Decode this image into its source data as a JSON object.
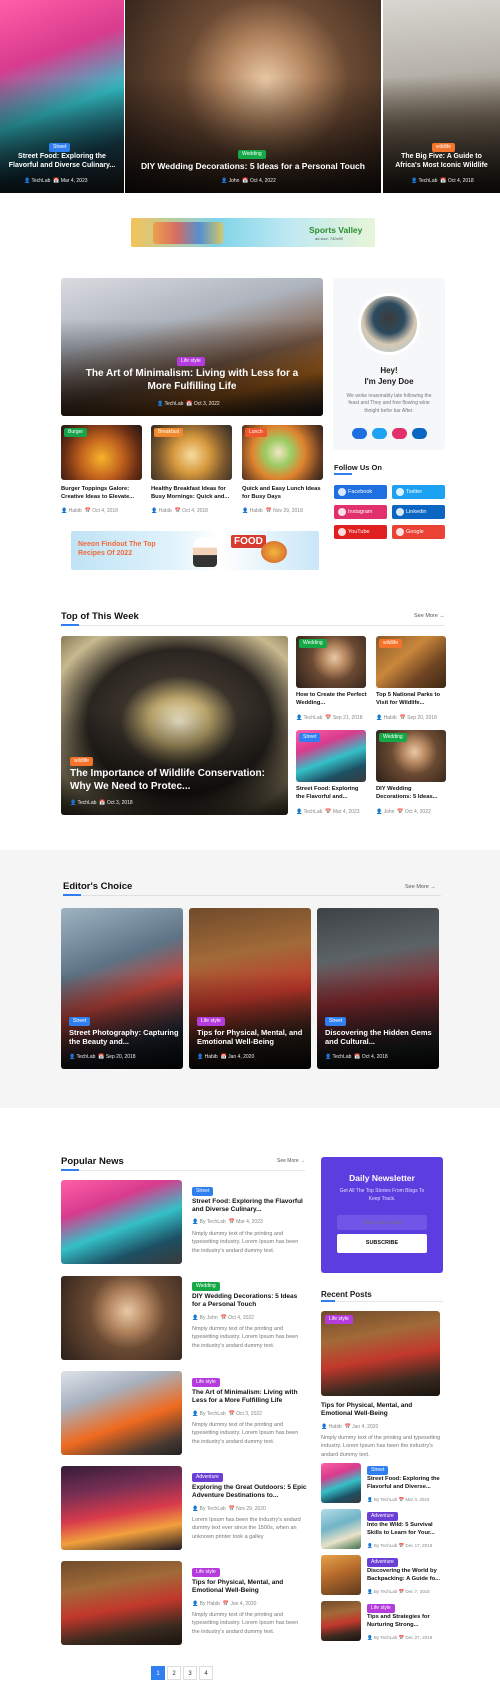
{
  "hero": [
    {
      "category": "Street",
      "title": "Street Food: Exploring the Flavorful and Diverse Culinary...",
      "author": "TechLab",
      "date": "Mar 4, 2023"
    },
    {
      "category": "Wedding",
      "title": "DIY Wedding Decorations: 5 Ideas for a Personal Touch",
      "author": "John",
      "date": "Oct 4, 2022"
    },
    {
      "category": "wildlife",
      "title": "The Big Five: A Guide to Africa's Most Iconic Wildlife",
      "author": "TechLab",
      "date": "Oct 4, 2018"
    }
  ],
  "banner_top": {
    "text": "Sports Valley",
    "sub": "ad size: 740x90"
  },
  "featured": {
    "category": "Life style",
    "title": "The Art of Minimalism: Living with Less for a More Fulfilling Life",
    "author": "TechLab",
    "date": "Oct 3, 2022"
  },
  "small_cards": [
    {
      "category": "Burger",
      "title": "Burger Toppings Galore: Creative Ideas to Elevate...",
      "author": "Habib",
      "date": "Oct 4, 2018"
    },
    {
      "category": "Breakfast",
      "title": "Healthy Breakfast Ideas for Busy Mornings: Quick and...",
      "author": "Habib",
      "date": "Oct 4, 2018"
    },
    {
      "category": "Lunch",
      "title": "Quick and Easy Lunch Ideas for Busy Days",
      "author": "Habib",
      "date": "Nov 29, 2018"
    }
  ],
  "profile": {
    "greeting": "Hey!",
    "name": "I'm Jeny Doe",
    "bio": "We woke reasonably late following the feast and They and free flowing wine thnight befor bar After."
  },
  "follow": {
    "title": "Follow Us On",
    "items": [
      {
        "label": "Facebook",
        "color": "#1e6fe0"
      },
      {
        "label": "Twitter",
        "color": "#1da1f2"
      },
      {
        "label": "Instagram",
        "color": "#e1306c"
      },
      {
        "label": "Linkedin",
        "color": "#0a66c2"
      },
      {
        "label": "YouTube",
        "color": "#e02020"
      },
      {
        "label": "Google",
        "color": "#ea4335"
      }
    ]
  },
  "banner_mid": {
    "text": "Neeon Findout The Top Recipes Of 2022",
    "badge": "FOOD"
  },
  "top_week": {
    "title": "Top of This Week",
    "see_more": "See More",
    "main": {
      "category": "wildlife",
      "title": "The Importance of Wildlife Conservation: Why We Need to Protec...",
      "author": "TechLab",
      "date": "Oct 3, 2018"
    },
    "items": [
      {
        "category": "Wedding",
        "title": "How to Create the Perfect Wedding...",
        "author": "TechLab",
        "date": "Sep 21, 2018"
      },
      {
        "category": "wildlife",
        "title": "Top 5 National Parks to Visit for Wildlife...",
        "author": "Habib",
        "date": "Sep 20, 2018"
      },
      {
        "category": "Street",
        "title": "Street Food: Exploring the Flavorful and...",
        "author": "TechLab",
        "date": "Mar 4, 2023"
      },
      {
        "category": "Wedding",
        "title": "DIY Wedding Decorations: 5 Ideas...",
        "author": "John",
        "date": "Oct 4, 2022"
      }
    ]
  },
  "editors": {
    "title": "Editor's Choice",
    "see_more": "See More",
    "items": [
      {
        "category": "Street",
        "title": "Street Photography: Capturing the Beauty and...",
        "author": "TechLab",
        "date": "Sep 20, 2018"
      },
      {
        "category": "Life style",
        "title": "Tips for Physical, Mental, and Emotional Well-Being",
        "author": "Habib",
        "date": "Jan 4, 2020"
      },
      {
        "category": "Street",
        "title": "Discovering the Hidden Gems and Cultural...",
        "author": "TechLab",
        "date": "Oct 4, 2018"
      }
    ]
  },
  "popular": {
    "title": "Popular News",
    "see_more": "See More",
    "excerpt": "Nmply dummy text of the printing and typesetting industry. Lorem Ipsum has been the industry's andard dummy text.",
    "items": [
      {
        "category": "Street",
        "title": "Street Food: Exploring the Flavorful and Diverse Culinary...",
        "author": "By TechLab",
        "date": "Mar 4, 2023"
      },
      {
        "category": "Wedding",
        "title": "DIY Wedding Decorations: 5 Ideas for a Personal Touch",
        "author": "By John",
        "date": "Oct 4, 2022"
      },
      {
        "category": "Life style",
        "title": "The Art of Minimalism: Living with Less for a More Fulfilling Life",
        "author": "By TechLab",
        "date": "Oct 3, 2022"
      },
      {
        "category": "Adventure",
        "title": "Exploring the Great Outdoors: 5 Epic Adventure Destinations to...",
        "author": "By TechLab",
        "date": "Nov 29, 2020",
        "excerpt": "Lorem Ipsum has been the industry's andard dummy text ever since the 1500s, when an unknown printer took a galley"
      },
      {
        "category": "Life style",
        "title": "Tips for Physical, Mental, and Emotional Well-Being",
        "author": "By Habib",
        "date": "Jan 4, 2020"
      }
    ]
  },
  "newsletter": {
    "title": "Daily Newsletter",
    "subtitle": "Get All The Top Stories From Blogs To Keep Track.",
    "placeholder": "Enter your e-mail",
    "button": "SUBSCRIBE"
  },
  "recent": {
    "title": "Recent Posts",
    "main": {
      "category": "Life style",
      "title": "Tips for Physical, Mental, and Emotional Well-Being",
      "author": "Habib",
      "date": "Jan 4, 2020",
      "excerpt": "Nmply dummy text of the printing and typesetting industry. Lorem Ipsum has been the industry's andard dummy text."
    },
    "items": [
      {
        "category": "Street",
        "title": "Street Food: Exploring the Flavorful and Diverse...",
        "author": "By TechLab",
        "date": "Mar 4, 2023"
      },
      {
        "category": "Adventure",
        "title": "Into the Wild: 5 Survival Skills to Learn for Your...",
        "author": "By TechLab",
        "date": "Dec 17, 2018"
      },
      {
        "category": "Adventure",
        "title": "Discovering the World by Backpacking: A Guide fo...",
        "author": "By TechLab",
        "date": "Dec 7, 2018"
      },
      {
        "category": "Life style",
        "title": "Tips and Strategies for Nurturing Strong...",
        "author": "By TechLab",
        "date": "Dec 27, 2018"
      }
    ]
  },
  "pagination": [
    "1",
    "2",
    "3",
    "4"
  ]
}
